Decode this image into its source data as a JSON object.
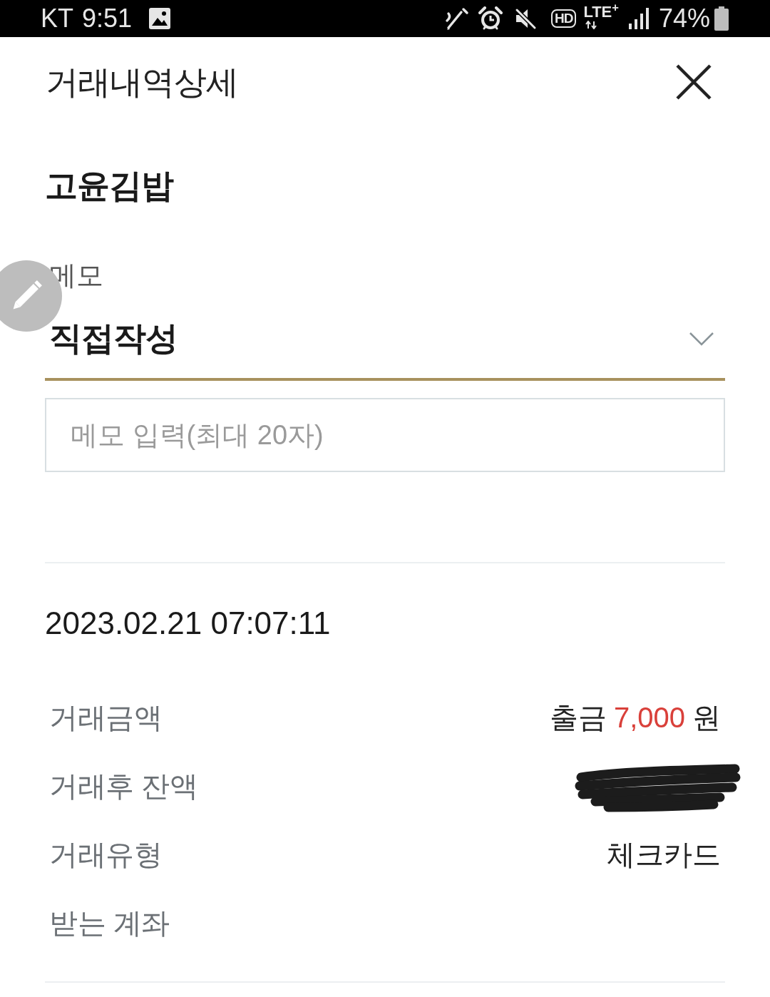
{
  "status_bar": {
    "carrier": "KT",
    "time": "9:51",
    "hd_label": "HD",
    "network": "LTE$^{+}$",
    "battery": "74%"
  },
  "header": {
    "title": "거래내역상세"
  },
  "merchant": {
    "name": "고윤김밥"
  },
  "memo": {
    "label": "메모",
    "select": {
      "value": "직접작성"
    },
    "input": {
      "placeholder": "메모 입력(최대 20자)"
    }
  },
  "transaction": {
    "datetime": "2023.02.21 07:07:11",
    "details": [
      {
        "label": "거래금액",
        "kind": "amount",
        "direction": "출금",
        "amount": "7,000",
        "unit": "원"
      },
      {
        "label": "거래후 잔액",
        "kind": "redacted"
      },
      {
        "label": "거래유형",
        "kind": "text",
        "value": "체크카드"
      },
      {
        "label": "받는 계좌",
        "kind": "empty"
      }
    ]
  }
}
